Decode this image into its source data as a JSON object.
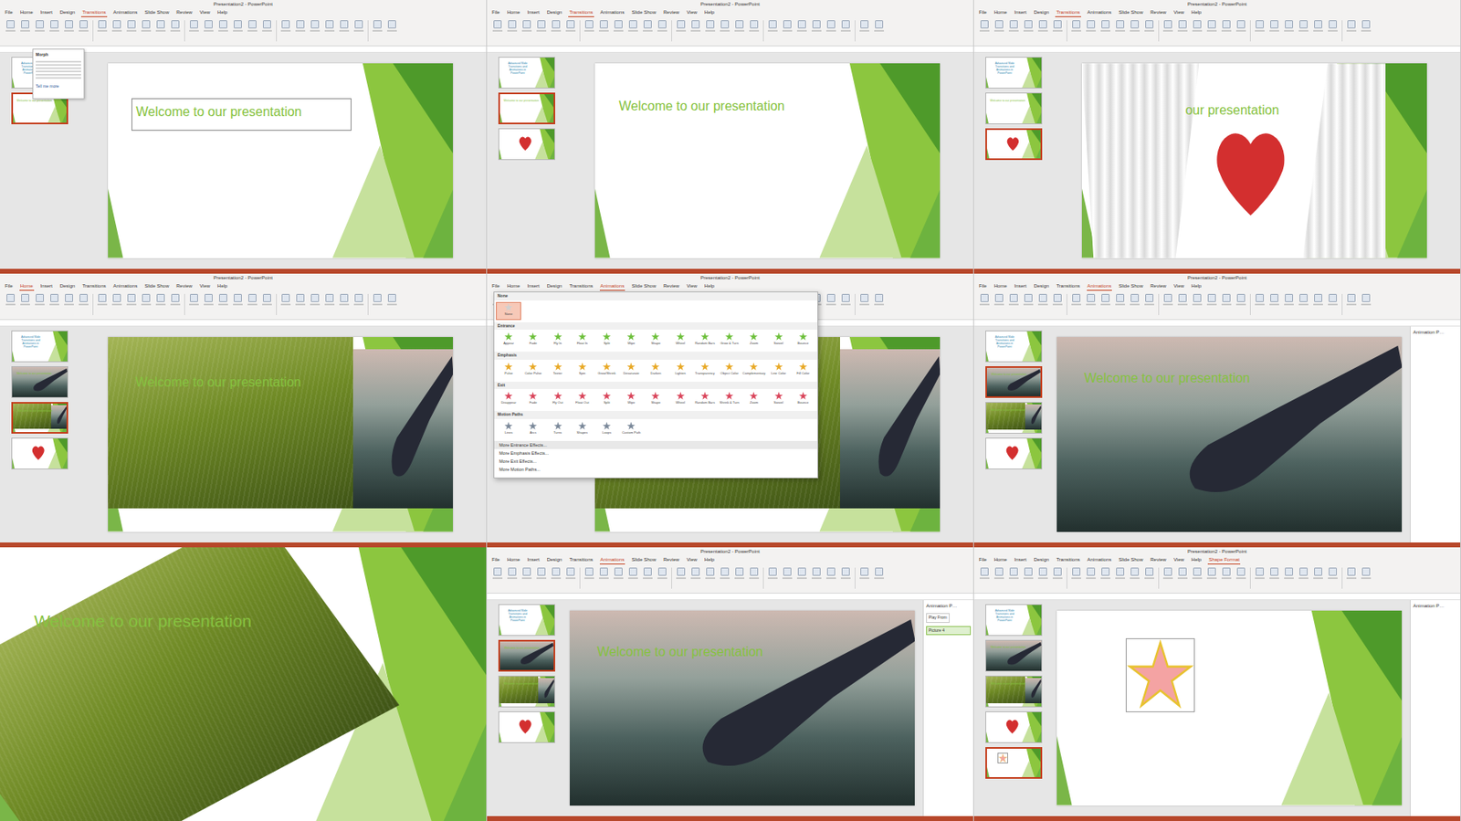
{
  "window": {
    "title": "Presentation2 - PowerPoint"
  },
  "panels": [
    {
      "kind": "editor",
      "title": "Presentation2 - PowerPoint",
      "tabs": [
        {
          "label": "File",
          "selected": false
        },
        {
          "label": "Home",
          "selected": false
        },
        {
          "label": "Insert",
          "selected": false
        },
        {
          "label": "Design",
          "selected": false
        },
        {
          "label": "Transitions",
          "selected": true
        },
        {
          "label": "Animations",
          "selected": false
        },
        {
          "label": "Slide Show",
          "selected": false
        },
        {
          "label": "Review",
          "selected": false
        },
        {
          "label": "View",
          "selected": false
        },
        {
          "label": "Help",
          "selected": false
        }
      ],
      "thumbs": [
        {
          "kind": "intro",
          "title": "Advanced Slide Transitions and Animations in PowerPoint",
          "selected": false
        },
        {
          "kind": "title",
          "title": "Welcome to our presentation",
          "selected": true
        }
      ],
      "slide": {
        "kind": "title",
        "title": "Welcome to our presentation",
        "text_selected": true
      },
      "tooltip": {
        "title": "Morph",
        "link": "Tell me more"
      }
    },
    {
      "kind": "editor",
      "title": "Presentation2 - PowerPoint",
      "tabs": [
        {
          "label": "File",
          "selected": false
        },
        {
          "label": "Home",
          "selected": false
        },
        {
          "label": "Insert",
          "selected": false
        },
        {
          "label": "Design",
          "selected": false
        },
        {
          "label": "Transitions",
          "selected": true
        },
        {
          "label": "Animations",
          "selected": false
        },
        {
          "label": "Slide Show",
          "selected": false
        },
        {
          "label": "Review",
          "selected": false
        },
        {
          "label": "View",
          "selected": false
        },
        {
          "label": "Help",
          "selected": false
        }
      ],
      "thumbs": [
        {
          "kind": "intro",
          "title": "Advanced Slide Transitions and Animations in PowerPoint",
          "selected": false
        },
        {
          "kind": "title",
          "title": "Welcome to our presentation",
          "selected": true
        },
        {
          "kind": "heart",
          "selected": false
        }
      ],
      "slide": {
        "kind": "title",
        "title": "Welcome to our presentation",
        "text_selected": false
      }
    },
    {
      "kind": "editor",
      "title": "Presentation2 - PowerPoint",
      "tabs": [
        {
          "label": "File",
          "selected": false
        },
        {
          "label": "Home",
          "selected": false
        },
        {
          "label": "Insert",
          "selected": false
        },
        {
          "label": "Design",
          "selected": false
        },
        {
          "label": "Transitions",
          "selected": true
        },
        {
          "label": "Animations",
          "selected": false
        },
        {
          "label": "Slide Show",
          "selected": false
        },
        {
          "label": "Review",
          "selected": false
        },
        {
          "label": "View",
          "selected": false
        },
        {
          "label": "Help",
          "selected": false
        }
      ],
      "thumbs": [
        {
          "kind": "intro",
          "title": "Advanced Slide Transitions and Animations in PowerPoint",
          "selected": false
        },
        {
          "kind": "title",
          "title": "Welcome to our presentation",
          "selected": false
        },
        {
          "kind": "heart",
          "selected": true
        }
      ],
      "slide": {
        "kind": "curtain",
        "title": "our presentation",
        "text_selected": false
      }
    },
    {
      "kind": "editor",
      "title": "Presentation2 - PowerPoint",
      "tabs": [
        {
          "label": "File",
          "selected": false
        },
        {
          "label": "Home",
          "selected": true
        },
        {
          "label": "Insert",
          "selected": false
        },
        {
          "label": "Design",
          "selected": false
        },
        {
          "label": "Transitions",
          "selected": false
        },
        {
          "label": "Animations",
          "selected": false
        },
        {
          "label": "Slide Show",
          "selected": false
        },
        {
          "label": "Review",
          "selected": false
        },
        {
          "label": "View",
          "selected": false
        },
        {
          "label": "Help",
          "selected": false
        }
      ],
      "thumbs": [
        {
          "kind": "intro",
          "title": "Advanced Slide Transitions and Animations in PowerPoint",
          "selected": false
        },
        {
          "kind": "paddle",
          "title": "Welcome to our presentation",
          "selected": false
        },
        {
          "kind": "photos",
          "title": "Welcome to our presentation",
          "selected": true
        },
        {
          "kind": "heart",
          "selected": false
        }
      ],
      "slide": {
        "kind": "photos",
        "title": "Welcome to our presentation",
        "text_selected": false
      }
    },
    {
      "kind": "editor",
      "title": "Presentation2 - PowerPoint",
      "tabs": [
        {
          "label": "File",
          "selected": false
        },
        {
          "label": "Home",
          "selected": false
        },
        {
          "label": "Insert",
          "selected": false
        },
        {
          "label": "Design",
          "selected": false
        },
        {
          "label": "Transitions",
          "selected": false
        },
        {
          "label": "Animations",
          "selected": true
        },
        {
          "label": "Slide Show",
          "selected": false
        },
        {
          "label": "Review",
          "selected": false
        },
        {
          "label": "View",
          "selected": false
        },
        {
          "label": "Help",
          "selected": false
        }
      ],
      "thumbs": [
        {
          "kind": "intro",
          "title": "Advanced Slide Transitions and Animations in PowerPoint",
          "selected": false
        },
        {
          "kind": "paddle",
          "title": "Welcome to our presentation",
          "selected": false
        },
        {
          "kind": "photos",
          "title": "Welcome to our presentation",
          "selected": true
        },
        {
          "kind": "heart",
          "selected": false
        }
      ],
      "slide": {
        "kind": "photos",
        "title": "Welcome to our presentation",
        "text_selected": false
      },
      "gallery": {
        "sections": [
          {
            "label": "None",
            "color": "#d0d0d0",
            "items": [
              {
                "label": "None",
                "selected": true
              }
            ]
          },
          {
            "label": "Entrance",
            "color": "#6cbf3a",
            "items": [
              {
                "label": "Appear",
                "selected": false
              },
              {
                "label": "Fade",
                "selected": false
              },
              {
                "label": "Fly In",
                "selected": false
              },
              {
                "label": "Float In",
                "selected": false
              },
              {
                "label": "Split",
                "selected": false
              },
              {
                "label": "Wipe",
                "selected": false
              },
              {
                "label": "Shape",
                "selected": false
              },
              {
                "label": "Wheel",
                "selected": false
              },
              {
                "label": "Random Bars",
                "selected": false
              },
              {
                "label": "Grow & Turn",
                "selected": false
              },
              {
                "label": "Zoom",
                "selected": false
              },
              {
                "label": "Swivel",
                "selected": false
              },
              {
                "label": "Bounce",
                "selected": false
              }
            ]
          },
          {
            "label": "Emphasis",
            "color": "#e8a825",
            "items": [
              {
                "label": "Pulse",
                "selected": false
              },
              {
                "label": "Color Pulse",
                "selected": false
              },
              {
                "label": "Teeter",
                "selected": false
              },
              {
                "label": "Spin",
                "selected": false
              },
              {
                "label": "Grow/Shrink",
                "selected": false
              },
              {
                "label": "Desaturate",
                "selected": false
              },
              {
                "label": "Darken",
                "selected": false
              },
              {
                "label": "Lighten",
                "selected": false
              },
              {
                "label": "Transparency",
                "selected": false
              },
              {
                "label": "Object Color",
                "selected": false
              },
              {
                "label": "Complementary",
                "selected": false
              },
              {
                "label": "Line Color",
                "selected": false
              },
              {
                "label": "Fill Color",
                "selected": false
              }
            ]
          },
          {
            "label": "Exit",
            "color": "#d9445a",
            "items": [
              {
                "label": "Disappear",
                "selected": false
              },
              {
                "label": "Fade",
                "selected": false
              },
              {
                "label": "Fly Out",
                "selected": false
              },
              {
                "label": "Float Out",
                "selected": false
              },
              {
                "label": "Split",
                "selected": false
              },
              {
                "label": "Wipe",
                "selected": false
              },
              {
                "label": "Shape",
                "selected": false
              },
              {
                "label": "Wheel",
                "selected": false
              },
              {
                "label": "Random Bars",
                "selected": false
              },
              {
                "label": "Shrink & Turn",
                "selected": false
              },
              {
                "label": "Zoom",
                "selected": false
              },
              {
                "label": "Swivel",
                "selected": false
              },
              {
                "label": "Bounce",
                "selected": false
              }
            ]
          },
          {
            "label": "Motion Paths",
            "color": "#7a8899",
            "items": [
              {
                "label": "Lines",
                "selected": false
              },
              {
                "label": "Arcs",
                "selected": false
              },
              {
                "label": "Turns",
                "selected": false
              },
              {
                "label": "Shapes",
                "selected": false
              },
              {
                "label": "Loops",
                "selected": false
              },
              {
                "label": "Custom Path",
                "selected": false
              }
            ]
          }
        ],
        "menu": [
          {
            "label": "More Entrance Effects...",
            "selected": true
          },
          {
            "label": "More Emphasis Effects...",
            "selected": false
          },
          {
            "label": "More Exit Effects...",
            "selected": false
          },
          {
            "label": "More Motion Paths...",
            "selected": false
          }
        ]
      }
    },
    {
      "kind": "editor",
      "title": "Presentation2 - PowerPoint",
      "tabs": [
        {
          "label": "File",
          "selected": false
        },
        {
          "label": "Home",
          "selected": false
        },
        {
          "label": "Insert",
          "selected": false
        },
        {
          "label": "Design",
          "selected": false
        },
        {
          "label": "Transitions",
          "selected": false
        },
        {
          "label": "Animations",
          "selected": true
        },
        {
          "label": "Slide Show",
          "selected": false
        },
        {
          "label": "Review",
          "selected": false
        },
        {
          "label": "View",
          "selected": false
        },
        {
          "label": "Help",
          "selected": false
        }
      ],
      "thumbs": [
        {
          "kind": "intro",
          "title": "Advanced Slide Transitions and Animations in PowerPoint",
          "selected": false
        },
        {
          "kind": "paddle",
          "title": "Welcome to our presentation",
          "selected": true
        },
        {
          "kind": "photos",
          "title": "Welcome to our presentation",
          "selected": false
        },
        {
          "kind": "heart",
          "selected": false
        }
      ],
      "slide": {
        "kind": "paddle",
        "title": "Welcome to our presentation",
        "text_selected": false
      },
      "anim_pane": {
        "title": "Animation P…",
        "items": []
      }
    },
    {
      "kind": "fullscreen",
      "slide": {
        "kind": "wheat",
        "title": "Welcome to our presentation",
        "text_selected": false
      }
    },
    {
      "kind": "editor",
      "title": "Presentation2 - PowerPoint",
      "tabs": [
        {
          "label": "File",
          "selected": false
        },
        {
          "label": "Home",
          "selected": false
        },
        {
          "label": "Insert",
          "selected": false
        },
        {
          "label": "Design",
          "selected": false
        },
        {
          "label": "Transitions",
          "selected": false
        },
        {
          "label": "Animations",
          "selected": true
        },
        {
          "label": "Slide Show",
          "selected": false
        },
        {
          "label": "Review",
          "selected": false
        },
        {
          "label": "View",
          "selected": false
        },
        {
          "label": "Help",
          "selected": false
        }
      ],
      "thumbs": [
        {
          "kind": "intro",
          "title": "Advanced Slide Transitions and Animations in PowerPoint",
          "selected": false
        },
        {
          "kind": "paddle",
          "title": "Welcome to our presentation",
          "selected": true
        },
        {
          "kind": "photos",
          "title": "Welcome to our presentation",
          "selected": false
        },
        {
          "kind": "heart",
          "selected": false
        }
      ],
      "slide": {
        "kind": "paddle",
        "title": "Welcome to our presentation",
        "text_selected": false
      },
      "anim_pane": {
        "title": "Animation P…",
        "play": "Play From",
        "items": [
          {
            "label": "Picture 4",
            "selected": true
          }
        ]
      }
    },
    {
      "kind": "editor",
      "title": "Presentation2 - PowerPoint",
      "tabs": [
        {
          "label": "File",
          "selected": false
        },
        {
          "label": "Home",
          "selected": false
        },
        {
          "label": "Insert",
          "selected": false
        },
        {
          "label": "Design",
          "selected": false
        },
        {
          "label": "Transitions",
          "selected": false
        },
        {
          "label": "Animations",
          "selected": false
        },
        {
          "label": "Slide Show",
          "selected": false
        },
        {
          "label": "Review",
          "selected": false
        },
        {
          "label": "View",
          "selected": false
        },
        {
          "label": "Help",
          "selected": false
        },
        {
          "label": "Shape Format",
          "selected": true
        }
      ],
      "thumbs": [
        {
          "kind": "intro",
          "title": "Advanced Slide Transitions and Animations in PowerPoint",
          "selected": false
        },
        {
          "kind": "paddle",
          "title": "Welcome to our presentation",
          "selected": false
        },
        {
          "kind": "photos",
          "title": "Welcome to our presentation",
          "selected": false
        },
        {
          "kind": "heart",
          "selected": false
        },
        {
          "kind": "star",
          "selected": true
        }
      ],
      "slide": {
        "kind": "star",
        "text_selected": false
      },
      "anim_pane": {
        "title": "Animation P…",
        "items": []
      }
    }
  ]
}
